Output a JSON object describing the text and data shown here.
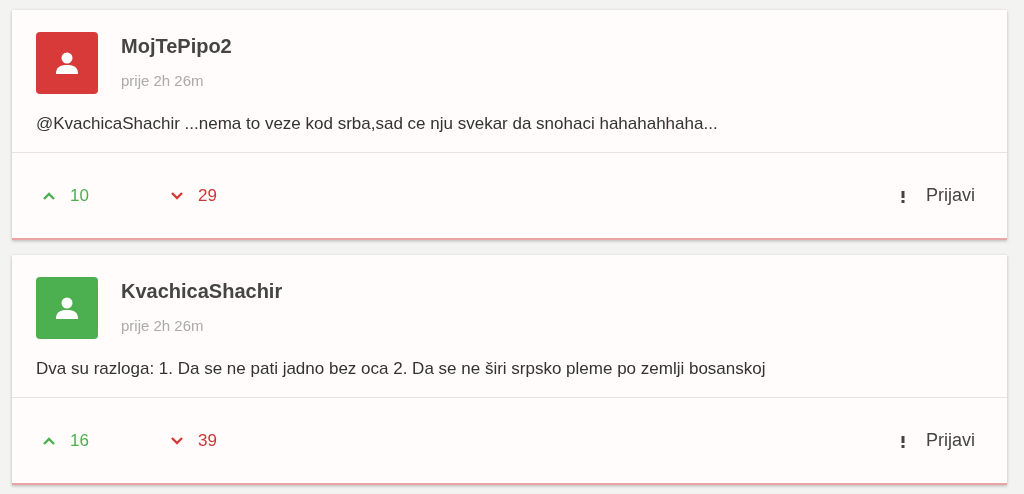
{
  "comments": [
    {
      "author": "MojTePipo2",
      "color": "#d83a3a",
      "time": "prije 2h 26m",
      "text": "@KvachicaShachir ...nema to veze kod srba,sad ce nju svekar da snohaci hahahahhaha...",
      "upvotes": "10",
      "downvotes": "29",
      "report": "Prijavi"
    },
    {
      "author": "KvachicaShachir",
      "color": "#4caf50",
      "time": "prije 2h 26m",
      "text": "Dva su razloga: 1. Da se ne pati jadno bez oca 2. Da se ne širi srpsko pleme po zemlji bosanskoj",
      "upvotes": "16",
      "downvotes": "39",
      "report": "Prijavi"
    }
  ]
}
